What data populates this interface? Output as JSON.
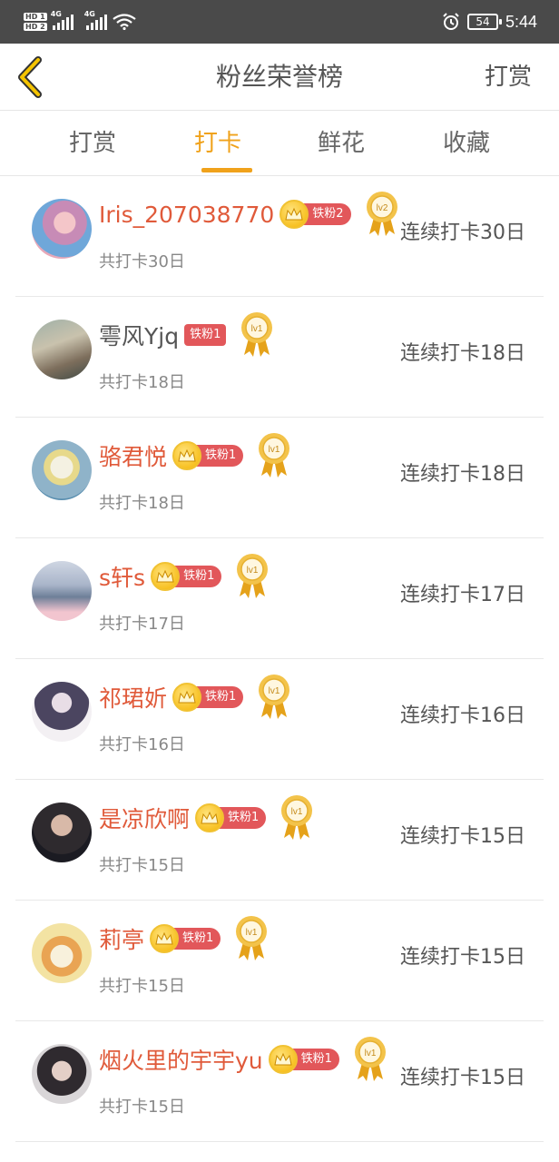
{
  "status_bar": {
    "hd1": "HD 1",
    "hd2": "HD 2",
    "net1": "4G",
    "net2": "4G",
    "battery": "54",
    "time": "5:44"
  },
  "header": {
    "title": "粉丝荣誉榜",
    "right_action": "打赏"
  },
  "tabs": [
    {
      "label": "打赏",
      "active": false
    },
    {
      "label": "打卡",
      "active": true
    },
    {
      "label": "鲜花",
      "active": false
    },
    {
      "label": "收藏",
      "active": false
    }
  ],
  "rows": [
    {
      "name": "Iris_207038770",
      "badge": "铁粉2",
      "level": "lv2",
      "total": "共打卡30日",
      "streak": "连续打卡30日"
    },
    {
      "name": "雩风Yjq",
      "badge": "铁粉1",
      "level": "lv1",
      "total": "共打卡18日",
      "streak": "连续打卡18日"
    },
    {
      "name": "骆君悦",
      "badge": "铁粉1",
      "level": "lv1",
      "total": "共打卡18日",
      "streak": "连续打卡18日"
    },
    {
      "name": "s轩s",
      "badge": "铁粉1",
      "level": "lv1",
      "total": "共打卡17日",
      "streak": "连续打卡17日"
    },
    {
      "name": "祁珺妡",
      "badge": "铁粉1",
      "level": "lv1",
      "total": "共打卡16日",
      "streak": "连续打卡16日"
    },
    {
      "name": "是凉欣啊",
      "badge": "铁粉1",
      "level": "lv1",
      "total": "共打卡15日",
      "streak": "连续打卡15日"
    },
    {
      "name": "莉亭",
      "badge": "铁粉1",
      "level": "lv1",
      "total": "共打卡15日",
      "streak": "连续打卡15日"
    },
    {
      "name": "烟火里的宇宇yu",
      "badge": "铁粉1",
      "level": "lv1",
      "total": "共打卡15日",
      "streak": "连续打卡15日"
    }
  ],
  "icons": {
    "back": "chevron-left-icon",
    "alarm": "alarm-clock-icon",
    "wifi": "wifi-icon",
    "crown": "crown-icon",
    "medal": "medal-icon"
  },
  "colors": {
    "accent": "#f0a21b",
    "name": "#e05a3a",
    "badge": "#e2575a",
    "status_bar": "#4a4a4a"
  }
}
